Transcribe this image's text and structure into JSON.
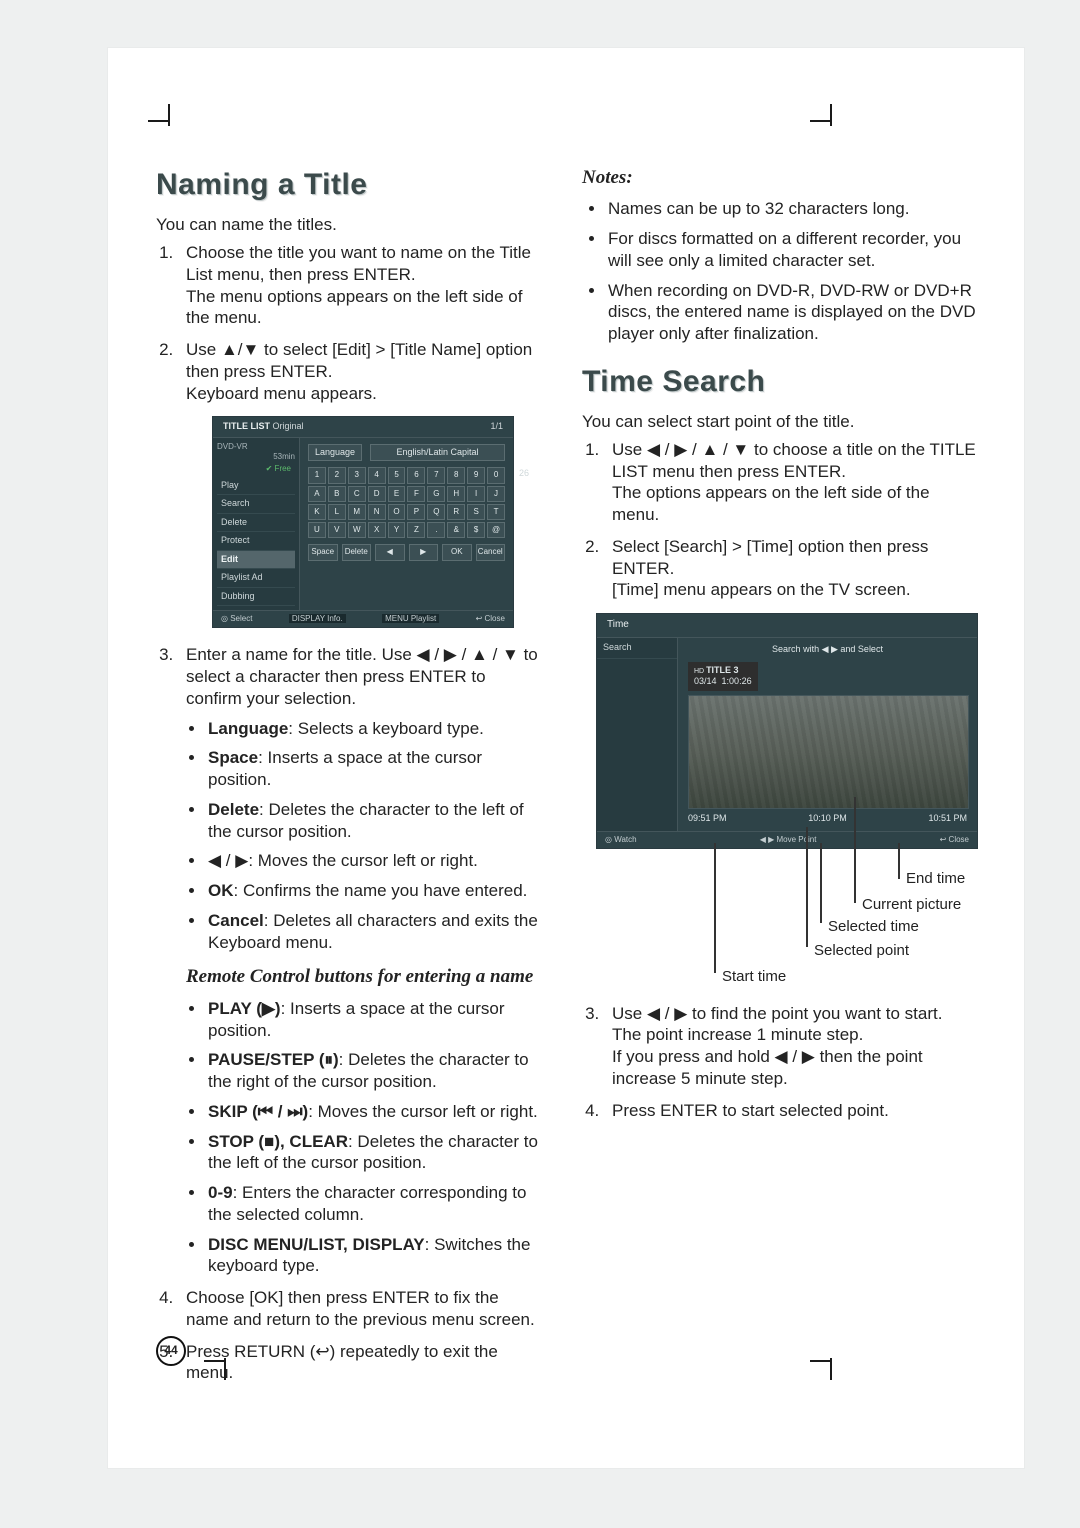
{
  "page_number": "44",
  "left": {
    "heading": "Naming a Title",
    "intro": "You can name the titles.",
    "step1": "Choose the title you want to name on the Title List menu, then press ENTER.\nThe menu options appears on the left side of the menu.",
    "step2": "Use ▲/▼ to select [Edit] > [Title Name] option then press ENTER.\nKeyboard menu appears.",
    "step3_lead": "Enter a name for the title. Use ◀ / ▶ / ▲ / ▼ to select a character then press ENTER to confirm your selection.",
    "b1_k": "Language",
    "b1_t": ": Selects a keyboard type.",
    "b2_k": "Space",
    "b2_t": ": Inserts a space at the cursor position.",
    "b3_k": "Delete",
    "b3_t": ": Deletes the character to the left of the cursor position.",
    "b4_t": "◀ / ▶: Moves the cursor left or right.",
    "b5_k": "OK",
    "b5_t": ": Confirms the name you have entered.",
    "b6_k": "Cancel",
    "b6_t": ": Deletes all characters and exits the Keyboard menu.",
    "remote_subhead": "Remote Control buttons for entering a name",
    "r1_k": "PLAY (▶)",
    "r1_t": ": Inserts a space at the cursor position.",
    "r2_k": "PAUSE/STEP (⏸)",
    "r2_t": ": Deletes the character to the right of the cursor position.",
    "r3_k": "SKIP (⏮ / ⏭)",
    "r3_t": ": Moves the cursor left or right.",
    "r4_k": "STOP (■), CLEAR",
    "r4_t": ": Deletes the character to the left of the cursor position.",
    "r5_k": "0-9",
    "r5_t": ": Enters the character corresponding to the selected column.",
    "r6_k": "DISC MENU/LIST, DISPLAY",
    "r6_t": ": Switches the keyboard type.",
    "step4": "Choose [OK] then press ENTER to fix the name and return to the previous menu screen.",
    "step5": "Press RETURN (↩) repeatedly to exit the menu."
  },
  "kb_shot": {
    "title_left": "TITLE LIST",
    "title_right": "Original",
    "page": "1/1",
    "left_device": "DVD-VR",
    "left_time": "53min",
    "left_free": "✔ Free",
    "left_free_num": "26",
    "menu": [
      "Play",
      "Search",
      "Delete",
      "Protect",
      "Edit",
      "Playlist Ad",
      "Dubbing"
    ],
    "lang_label": "Language",
    "lang_caption": "English/Latin Capital",
    "rows": [
      [
        "1",
        "2",
        "3",
        "4",
        "5",
        "6",
        "7",
        "8",
        "9",
        "0"
      ],
      [
        "A",
        "B",
        "C",
        "D",
        "E",
        "F",
        "G",
        "H",
        "I",
        "J"
      ],
      [
        "K",
        "L",
        "M",
        "N",
        "O",
        "P",
        "Q",
        "R",
        "S",
        "T"
      ],
      [
        "U",
        "V",
        "W",
        "X",
        "Y",
        "Z",
        ".",
        "&",
        "$",
        "@"
      ]
    ],
    "btns": [
      "Space",
      "Delete",
      "◀",
      "▶",
      "OK",
      "Cancel"
    ],
    "foot_select": "◎ Select",
    "foot_info": "DISPLAY Info.",
    "foot_playlist": "MENU Playlist",
    "foot_close": "↩ Close"
  },
  "right": {
    "notes_label": "Notes:",
    "n1": "Names can be up to 32 characters long.",
    "n2": "For discs formatted on a different recorder, you will see only a limited character set.",
    "n3": "When recording on DVD-R, DVD-RW or DVD+R discs, the entered name is displayed on the DVD player only after finalization.",
    "heading": "Time Search",
    "intro": "You can select start point of the title.",
    "step1": "Use ◀ / ▶ / ▲ / ▼ to choose a title on the TITLE LIST menu then press ENTER.\nThe options appears on the left side of the menu.",
    "step2": "Select [Search] > [Time] option then press ENTER.\n[Time] menu appears on the TV screen.",
    "step3": "Use ◀ / ▶ to find the point you want to start. The point increase 1 minute step.\nIf you press and hold ◀ / ▶ then the point increase 5 minute step.",
    "step4": "Press ENTER to start selected point."
  },
  "ts_shot": {
    "head": "Time",
    "left_item": "Search",
    "hint": "Search with ◀ ▶ and Select",
    "badge_title": "TITLE 3",
    "badge_date": "03/14",
    "badge_dur": "1:00:26",
    "t_left": "09:51 PM",
    "t_mid": "10:10 PM",
    "t_right": "10:51 PM",
    "foot_watch": "◎ Watch",
    "foot_move": "◀ ▶ Move Point",
    "foot_close": "↩ Close"
  },
  "callouts": {
    "end": "End time",
    "current": "Current picture",
    "selected_time": "Selected time",
    "selected_point": "Selected point",
    "start": "Start time"
  }
}
